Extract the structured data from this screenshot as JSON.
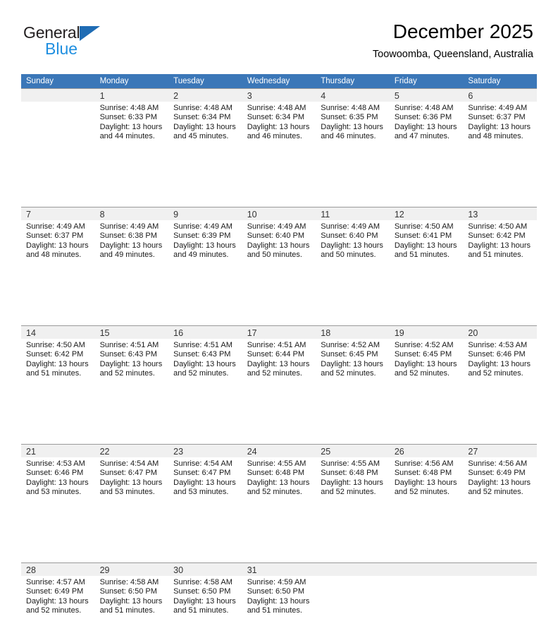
{
  "brand": {
    "name_part1": "General",
    "name_part2": "Blue",
    "triangle_icon": "triangle-icon",
    "accent_dark": "#231f20",
    "accent_blue": "#1f8fe0",
    "triangle_blue": "#1f6cb4"
  },
  "header": {
    "title": "December 2025",
    "subtitle": "Toowoomba, Queensland, Australia"
  },
  "calendar": {
    "header_bg": "#3b77b8",
    "daynum_bg": "#f0f0f0",
    "weekdays": [
      "Sunday",
      "Monday",
      "Tuesday",
      "Wednesday",
      "Thursday",
      "Friday",
      "Saturday"
    ],
    "weeks": [
      [
        {
          "day": "",
          "sunrise": "",
          "sunset": "",
          "daylight": ""
        },
        {
          "day": "1",
          "sunrise": "Sunrise: 4:48 AM",
          "sunset": "Sunset: 6:33 PM",
          "daylight": "Daylight: 13 hours and 44 minutes."
        },
        {
          "day": "2",
          "sunrise": "Sunrise: 4:48 AM",
          "sunset": "Sunset: 6:34 PM",
          "daylight": "Daylight: 13 hours and 45 minutes."
        },
        {
          "day": "3",
          "sunrise": "Sunrise: 4:48 AM",
          "sunset": "Sunset: 6:34 PM",
          "daylight": "Daylight: 13 hours and 46 minutes."
        },
        {
          "day": "4",
          "sunrise": "Sunrise: 4:48 AM",
          "sunset": "Sunset: 6:35 PM",
          "daylight": "Daylight: 13 hours and 46 minutes."
        },
        {
          "day": "5",
          "sunrise": "Sunrise: 4:48 AM",
          "sunset": "Sunset: 6:36 PM",
          "daylight": "Daylight: 13 hours and 47 minutes."
        },
        {
          "day": "6",
          "sunrise": "Sunrise: 4:49 AM",
          "sunset": "Sunset: 6:37 PM",
          "daylight": "Daylight: 13 hours and 48 minutes."
        }
      ],
      [
        {
          "day": "7",
          "sunrise": "Sunrise: 4:49 AM",
          "sunset": "Sunset: 6:37 PM",
          "daylight": "Daylight: 13 hours and 48 minutes."
        },
        {
          "day": "8",
          "sunrise": "Sunrise: 4:49 AM",
          "sunset": "Sunset: 6:38 PM",
          "daylight": "Daylight: 13 hours and 49 minutes."
        },
        {
          "day": "9",
          "sunrise": "Sunrise: 4:49 AM",
          "sunset": "Sunset: 6:39 PM",
          "daylight": "Daylight: 13 hours and 49 minutes."
        },
        {
          "day": "10",
          "sunrise": "Sunrise: 4:49 AM",
          "sunset": "Sunset: 6:40 PM",
          "daylight": "Daylight: 13 hours and 50 minutes."
        },
        {
          "day": "11",
          "sunrise": "Sunrise: 4:49 AM",
          "sunset": "Sunset: 6:40 PM",
          "daylight": "Daylight: 13 hours and 50 minutes."
        },
        {
          "day": "12",
          "sunrise": "Sunrise: 4:50 AM",
          "sunset": "Sunset: 6:41 PM",
          "daylight": "Daylight: 13 hours and 51 minutes."
        },
        {
          "day": "13",
          "sunrise": "Sunrise: 4:50 AM",
          "sunset": "Sunset: 6:42 PM",
          "daylight": "Daylight: 13 hours and 51 minutes."
        }
      ],
      [
        {
          "day": "14",
          "sunrise": "Sunrise: 4:50 AM",
          "sunset": "Sunset: 6:42 PM",
          "daylight": "Daylight: 13 hours and 51 minutes."
        },
        {
          "day": "15",
          "sunrise": "Sunrise: 4:51 AM",
          "sunset": "Sunset: 6:43 PM",
          "daylight": "Daylight: 13 hours and 52 minutes."
        },
        {
          "day": "16",
          "sunrise": "Sunrise: 4:51 AM",
          "sunset": "Sunset: 6:43 PM",
          "daylight": "Daylight: 13 hours and 52 minutes."
        },
        {
          "day": "17",
          "sunrise": "Sunrise: 4:51 AM",
          "sunset": "Sunset: 6:44 PM",
          "daylight": "Daylight: 13 hours and 52 minutes."
        },
        {
          "day": "18",
          "sunrise": "Sunrise: 4:52 AM",
          "sunset": "Sunset: 6:45 PM",
          "daylight": "Daylight: 13 hours and 52 minutes."
        },
        {
          "day": "19",
          "sunrise": "Sunrise: 4:52 AM",
          "sunset": "Sunset: 6:45 PM",
          "daylight": "Daylight: 13 hours and 52 minutes."
        },
        {
          "day": "20",
          "sunrise": "Sunrise: 4:53 AM",
          "sunset": "Sunset: 6:46 PM",
          "daylight": "Daylight: 13 hours and 52 minutes."
        }
      ],
      [
        {
          "day": "21",
          "sunrise": "Sunrise: 4:53 AM",
          "sunset": "Sunset: 6:46 PM",
          "daylight": "Daylight: 13 hours and 53 minutes."
        },
        {
          "day": "22",
          "sunrise": "Sunrise: 4:54 AM",
          "sunset": "Sunset: 6:47 PM",
          "daylight": "Daylight: 13 hours and 53 minutes."
        },
        {
          "day": "23",
          "sunrise": "Sunrise: 4:54 AM",
          "sunset": "Sunset: 6:47 PM",
          "daylight": "Daylight: 13 hours and 53 minutes."
        },
        {
          "day": "24",
          "sunrise": "Sunrise: 4:55 AM",
          "sunset": "Sunset: 6:48 PM",
          "daylight": "Daylight: 13 hours and 52 minutes."
        },
        {
          "day": "25",
          "sunrise": "Sunrise: 4:55 AM",
          "sunset": "Sunset: 6:48 PM",
          "daylight": "Daylight: 13 hours and 52 minutes."
        },
        {
          "day": "26",
          "sunrise": "Sunrise: 4:56 AM",
          "sunset": "Sunset: 6:48 PM",
          "daylight": "Daylight: 13 hours and 52 minutes."
        },
        {
          "day": "27",
          "sunrise": "Sunrise: 4:56 AM",
          "sunset": "Sunset: 6:49 PM",
          "daylight": "Daylight: 13 hours and 52 minutes."
        }
      ],
      [
        {
          "day": "28",
          "sunrise": "Sunrise: 4:57 AM",
          "sunset": "Sunset: 6:49 PM",
          "daylight": "Daylight: 13 hours and 52 minutes."
        },
        {
          "day": "29",
          "sunrise": "Sunrise: 4:58 AM",
          "sunset": "Sunset: 6:50 PM",
          "daylight": "Daylight: 13 hours and 51 minutes."
        },
        {
          "day": "30",
          "sunrise": "Sunrise: 4:58 AM",
          "sunset": "Sunset: 6:50 PM",
          "daylight": "Daylight: 13 hours and 51 minutes."
        },
        {
          "day": "31",
          "sunrise": "Sunrise: 4:59 AM",
          "sunset": "Sunset: 6:50 PM",
          "daylight": "Daylight: 13 hours and 51 minutes."
        },
        {
          "day": "",
          "sunrise": "",
          "sunset": "",
          "daylight": ""
        },
        {
          "day": "",
          "sunrise": "",
          "sunset": "",
          "daylight": ""
        },
        {
          "day": "",
          "sunrise": "",
          "sunset": "",
          "daylight": ""
        }
      ]
    ]
  }
}
